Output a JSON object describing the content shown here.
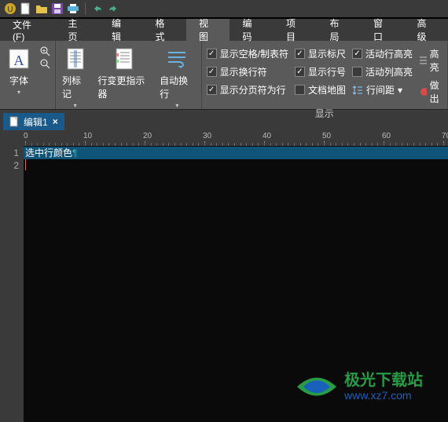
{
  "quick_access": {
    "buttons": [
      "new",
      "open",
      "save",
      "print",
      "undo",
      "redo"
    ]
  },
  "menu": {
    "items": [
      {
        "label": "文件(F)"
      },
      {
        "label": "主页"
      },
      {
        "label": "编辑"
      },
      {
        "label": "格式"
      },
      {
        "label": "视图",
        "active": true
      },
      {
        "label": "编码"
      },
      {
        "label": "项目"
      },
      {
        "label": "布局"
      },
      {
        "label": "窗口"
      },
      {
        "label": "高级"
      }
    ]
  },
  "ribbon": {
    "group1": {
      "font": "字体",
      "col_marker": "列标记",
      "change_indicator": "行变更指示器",
      "auto_wrap": "自动换行"
    },
    "group2": {
      "checks": {
        "show_space_tab": {
          "label": "显示空格/制表符",
          "checked": true
        },
        "show_ruler": {
          "label": "显示标尺",
          "checked": true
        },
        "active_row_highlight": {
          "label": "活动行高亮",
          "checked": true
        },
        "highlight": {
          "label": "高亮",
          "checked": false
        },
        "show_linebreak": {
          "label": "显示换行符",
          "checked": true
        },
        "show_lineno": {
          "label": "显示行号",
          "checked": true
        },
        "active_col_highlight": {
          "label": "活动列高亮",
          "checked": false
        },
        "make": {
          "label": "做出",
          "checked": false
        },
        "show_pagebreak": {
          "label": "显示分页符为行",
          "checked": true
        },
        "doc_map": {
          "label": "文档地图",
          "checked": false
        }
      },
      "line_spacing": "行间距",
      "group_label": "显示"
    }
  },
  "tabs": {
    "doc1": "编辑1"
  },
  "ruler": {
    "ticks": [
      0,
      10,
      20,
      30,
      40,
      50,
      60,
      70
    ]
  },
  "editor": {
    "line_numbers": [
      "1",
      "2"
    ],
    "line1_text": "选中行颜色",
    "para_mark": "¶"
  },
  "watermark": {
    "brand": "极光下载站",
    "host": "www.xz7.com"
  },
  "colors": {
    "bg_dark": "#0a0a0a",
    "panel": "#3a3a3a",
    "panel_light": "#5a5a5a",
    "selection": "#10547a",
    "tab_active": "#1a5a8a"
  }
}
